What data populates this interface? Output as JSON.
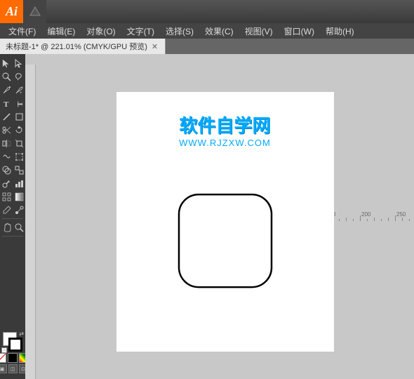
{
  "titleBar": {
    "appName": "Ai",
    "iconArrow": "▾"
  },
  "menuBar": {
    "items": [
      {
        "label": "文件(F)",
        "key": "file"
      },
      {
        "label": "编辑(E)",
        "key": "edit"
      },
      {
        "label": "对象(O)",
        "key": "object"
      },
      {
        "label": "文字(T)",
        "key": "text"
      },
      {
        "label": "选择(S)",
        "key": "select"
      },
      {
        "label": "效果(C)",
        "key": "effect"
      },
      {
        "label": "视图(V)",
        "key": "view"
      },
      {
        "label": "窗口(W)",
        "key": "window"
      },
      {
        "label": "帮助(H)",
        "key": "help"
      }
    ]
  },
  "tabBar": {
    "tabs": [
      {
        "label": "未标题-1* @ 221.01% (CMYK/GPU 预览)",
        "key": "tab1",
        "active": true
      }
    ]
  },
  "watermark": {
    "title": "软件自学网",
    "url": "WWW.RJZXW.COM"
  },
  "canvas": {
    "zoom": "221.01%",
    "colorMode": "CMYK/GPU 预览",
    "fileName": "未标题-1*"
  },
  "colors": {
    "none": "none",
    "black": "#000000"
  }
}
